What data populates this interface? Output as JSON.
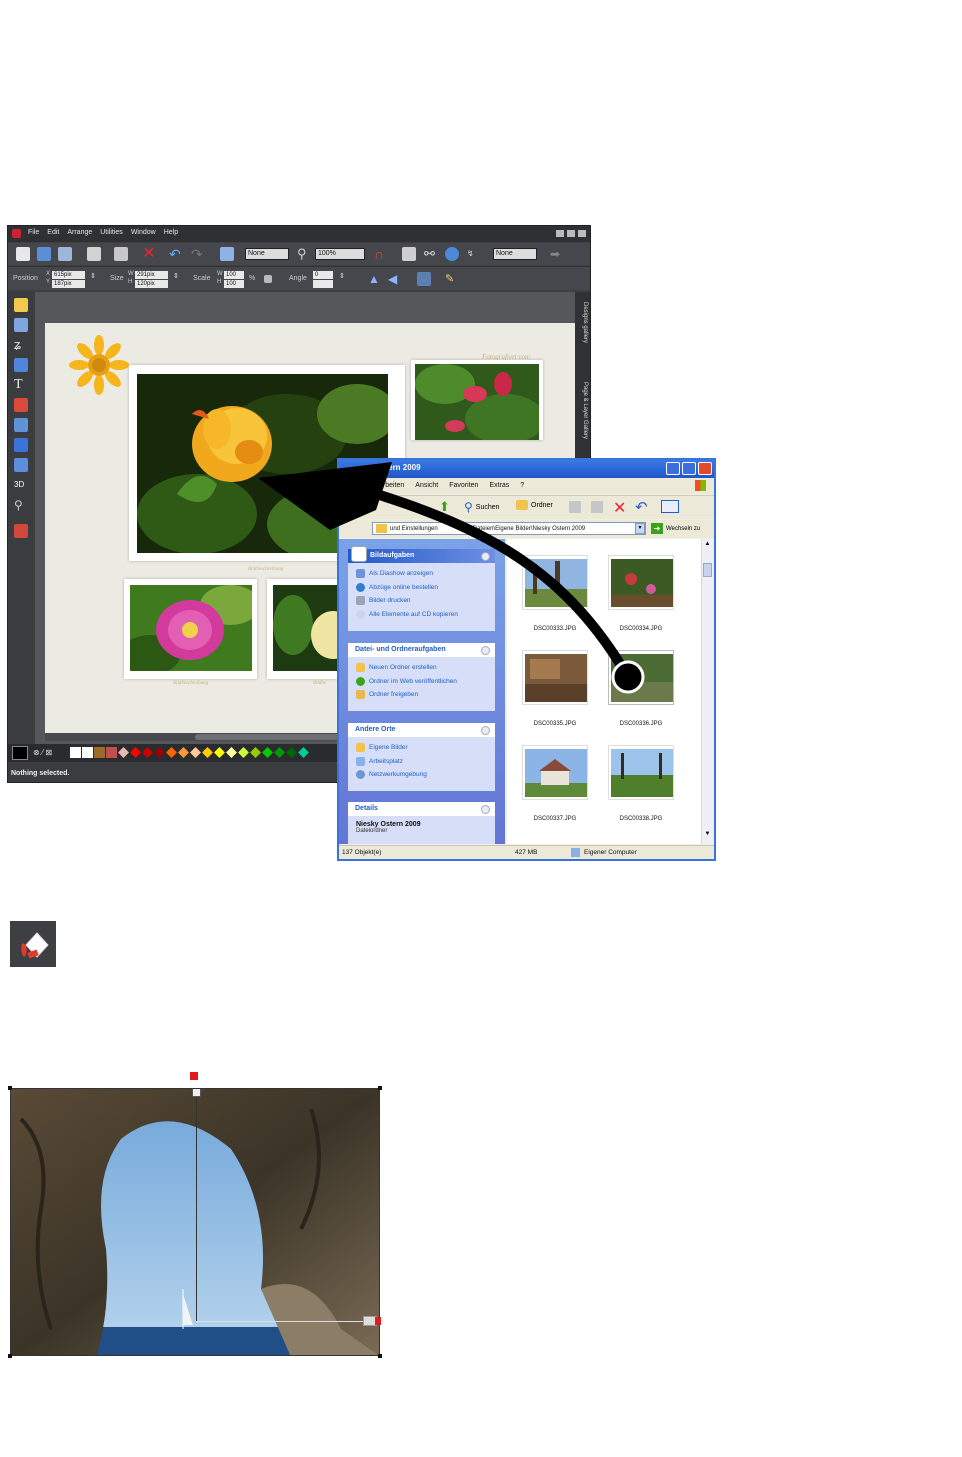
{
  "xara": {
    "menu": [
      "File",
      "Edit",
      "Arrange",
      "Utilities",
      "Window",
      "Help"
    ],
    "toolbar": {
      "select_none_1": "None",
      "zoom_value": "100%",
      "select_none_2": "None"
    },
    "infobar": {
      "position_label": "Position",
      "x_label": "X",
      "y_label": "Y",
      "x_value": "615pix",
      "y_value": "187pix",
      "size_label": "Size",
      "w_label": "W",
      "h_label": "H",
      "w_value": "291pix",
      "h_value": "120pix",
      "scale_label": "Scale",
      "scale_w": "100",
      "scale_h": "100",
      "scale_unit": "%",
      "angle_label": "Angle",
      "angle_value": "0"
    },
    "right_tabs": [
      "Designs gallery",
      "Page & Layer Gallery"
    ],
    "page": {
      "handwriting": "Fotografiert von:",
      "caption_main": "Bildbeschreibung",
      "caption_small_1": "Bildbeschreibung",
      "caption_small_2": "Bildbe"
    },
    "status": "Nothing selected."
  },
  "explorer": {
    "title": "stern 2009",
    "menu": [
      "arbeiten",
      "Ansicht",
      "Favoriten",
      "Extras",
      "?"
    ],
    "toolbar": {
      "search": "Suchen",
      "folders": "Ordner"
    },
    "address": {
      "left_text": "und Einstellungen",
      "path": "ene Dateien\\Eigene Bilder\\Niesky Ostern 2009",
      "go": "Wechseln zu"
    },
    "tasks": {
      "bild_title": "Bildaufgaben",
      "bild_items": [
        "Als Diashow anzeigen",
        "Abzüge online bestellen",
        "Bilder drucken",
        "Alle Elemente auf CD kopieren"
      ],
      "datei_title": "Datei- und Ordneraufgaben",
      "datei_items": [
        "Neuen Ordner erstellen",
        "Ordner im Web veröffentlichen",
        "Ordner freigeben"
      ],
      "orte_title": "Andere Orte",
      "orte_items": [
        "Eigene Bilder",
        "Arbeitsplatz",
        "Netzwerkumgebung"
      ],
      "details_title": "Details",
      "details_name": "Niesky Ostern 2009",
      "details_type": "Dateiordner"
    },
    "files": [
      "DSC00333.JPG",
      "DSC00334.JPG",
      "DSC00335.JPG",
      "DSC00336.JPG",
      "DSC00337.JPG",
      "DSC00338.JPG"
    ],
    "status": {
      "count": "137 Objekt(e)",
      "size": "427 MB",
      "location": "Eigener Computer"
    }
  },
  "colors": {
    "xara_bg": "#3d3f43",
    "xp_blue": "#2458d0",
    "handle_red": "#e31b1b"
  }
}
